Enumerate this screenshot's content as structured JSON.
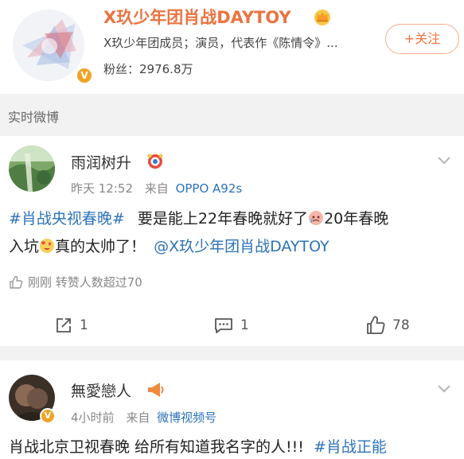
{
  "profile": {
    "name": "X玖少年团肖战DAYTOY",
    "description": "X玖少年团成员；演员，代表作《陈情令》...",
    "fans": "粉丝：2976.8万",
    "follow_label": "+关注"
  },
  "section": {
    "label": "实时微博"
  },
  "posts": [
    {
      "username": "雨润树升",
      "time": "昨天 12:52",
      "from_label": "来自",
      "source": "OPPO A92s",
      "line1": {
        "topic": "#肖战央视春晚#",
        "text_a": "要是能上22年春晚就好了",
        "text_b": "20年春晚"
      },
      "line2": {
        "text_a": "入坑",
        "text_b": "真的太帅了！",
        "mention": "@X玖少年团肖战DAYTOY"
      },
      "like_info": "刚刚 转赞人数超过70",
      "repost_count": "1",
      "comment_count": "1",
      "like_count": "78"
    },
    {
      "username": "無愛戀人",
      "time": "4小时前",
      "from_label": "来自",
      "source": "微博视频号",
      "line1": {
        "text_a": "肖战北京卫视春晚 给所有知道我名字的人!!!",
        "topic": "#肖战正能"
      }
    }
  ],
  "colors": {
    "accent_orange": "#eb7340",
    "link_blue": "#2d73b9",
    "muted": "#888888",
    "background_gray": "#f2f2f2"
  },
  "icons": {
    "follow": "plus-icon",
    "verified": "verified-badge-icon",
    "crown": "crown-icon",
    "menu": "chevron-down-icon",
    "like_small": "thumbs-up-icon",
    "repost": "repost-icon",
    "comment": "comment-icon",
    "like": "thumbs-up-icon"
  }
}
